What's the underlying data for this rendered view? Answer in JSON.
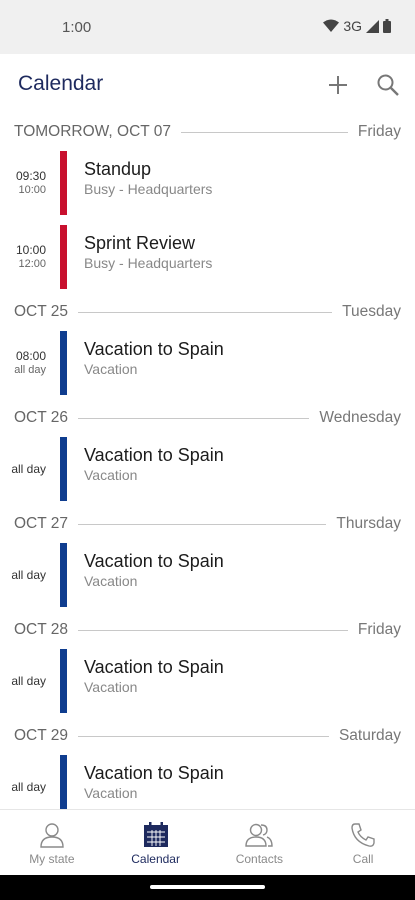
{
  "status_bar": {
    "time": "1:00",
    "network": "3G"
  },
  "header": {
    "title": "Calendar",
    "add_icon": "plus-icon",
    "search_icon": "search-icon"
  },
  "colors": {
    "accent": "#1e2a5e",
    "busy": "#c8102e",
    "vacation": "#0f3d8f"
  },
  "days": [
    {
      "date": "TOMORROW, OCT 07",
      "weekday": "Friday",
      "events": [
        {
          "start": "09:30",
          "end": "10:00",
          "title": "Standup",
          "subtitle": "Busy - Headquarters",
          "color": "#c8102e"
        },
        {
          "start": "10:00",
          "end": "12:00",
          "title": "Sprint Review",
          "subtitle": "Busy - Headquarters",
          "color": "#c8102e"
        }
      ]
    },
    {
      "date": "OCT 25",
      "weekday": "Tuesday",
      "events": [
        {
          "start": "08:00",
          "end": "all day",
          "title": "Vacation to Spain",
          "subtitle": "Vacation",
          "color": "#0f3d8f"
        }
      ]
    },
    {
      "date": "OCT 26",
      "weekday": "Wednesday",
      "events": [
        {
          "allday": "all day",
          "title": "Vacation to Spain",
          "subtitle": "Vacation",
          "color": "#0f3d8f"
        }
      ]
    },
    {
      "date": "OCT 27",
      "weekday": "Thursday",
      "events": [
        {
          "allday": "all day",
          "title": "Vacation to Spain",
          "subtitle": "Vacation",
          "color": "#0f3d8f"
        }
      ]
    },
    {
      "date": "OCT 28",
      "weekday": "Friday",
      "events": [
        {
          "allday": "all day",
          "title": "Vacation to Spain",
          "subtitle": "Vacation",
          "color": "#0f3d8f"
        }
      ]
    },
    {
      "date": "OCT 29",
      "weekday": "Saturday",
      "events": [
        {
          "allday": "all day",
          "title": "Vacation to Spain",
          "subtitle": "Vacation",
          "color": "#0f3d8f"
        }
      ]
    }
  ],
  "bottom_nav": [
    {
      "label": "My state",
      "icon": "person-icon",
      "active": false
    },
    {
      "label": "Calendar",
      "icon": "calendar-icon",
      "active": true
    },
    {
      "label": "Contacts",
      "icon": "contacts-icon",
      "active": false
    },
    {
      "label": "Call",
      "icon": "phone-icon",
      "active": false
    }
  ]
}
